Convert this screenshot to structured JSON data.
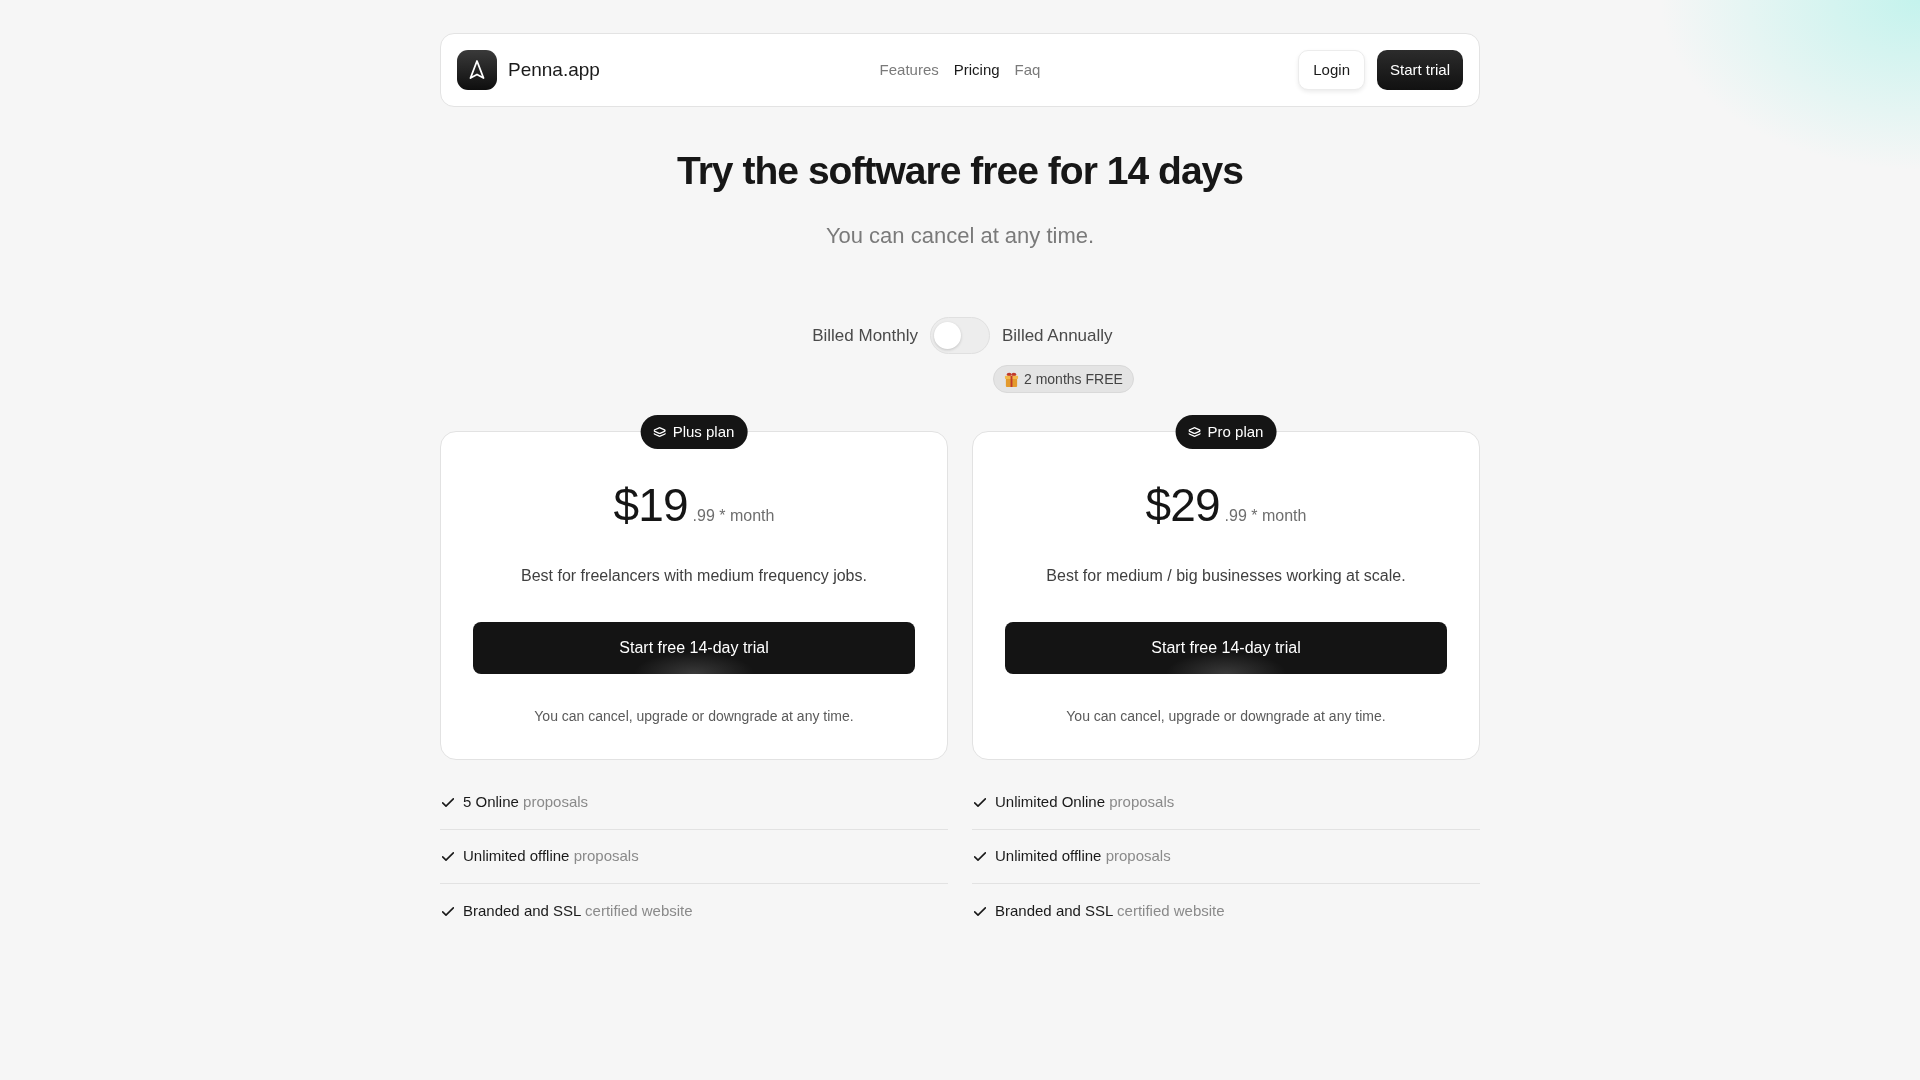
{
  "nav": {
    "brand": "Penna.app",
    "links": [
      {
        "label": "Features",
        "selected": false
      },
      {
        "label": "Pricing",
        "selected": true
      },
      {
        "label": "Faq",
        "selected": false
      }
    ],
    "login": "Login",
    "cta": "Start trial"
  },
  "hero": {
    "title": "Try the software free for 14 days",
    "subtitle": "You can cancel at any time."
  },
  "billing": {
    "monthly_label": "Billed Monthly",
    "annual_label": "Billed Annually",
    "annual": false,
    "badge": "2 months FREE"
  },
  "plans": [
    {
      "name": "Plus plan",
      "price": "$19",
      "price_suffix": ".99 * month",
      "description": "Best for freelancers with medium frequency jobs.",
      "button": "Start free 14-day trial",
      "note": "You can cancel, upgrade or downgrade at any time.",
      "features": [
        {
          "highlight": "5 Online",
          "detail": "proposals"
        },
        {
          "highlight": "Unlimited offline",
          "detail": "proposals"
        },
        {
          "highlight": "Branded and SSL",
          "detail": "certified website"
        }
      ]
    },
    {
      "name": "Pro plan",
      "price": "$29",
      "price_suffix": ".99 * month",
      "description": "Best for medium / big businesses working at scale.",
      "button": "Start free 14-day trial",
      "note": "You can cancel, upgrade or downgrade at any time.",
      "features": [
        {
          "highlight": "Unlimited Online",
          "detail": "proposals"
        },
        {
          "highlight": "Unlimited offline",
          "detail": "proposals"
        },
        {
          "highlight": "Branded and SSL",
          "detail": "certified website"
        }
      ]
    }
  ]
}
